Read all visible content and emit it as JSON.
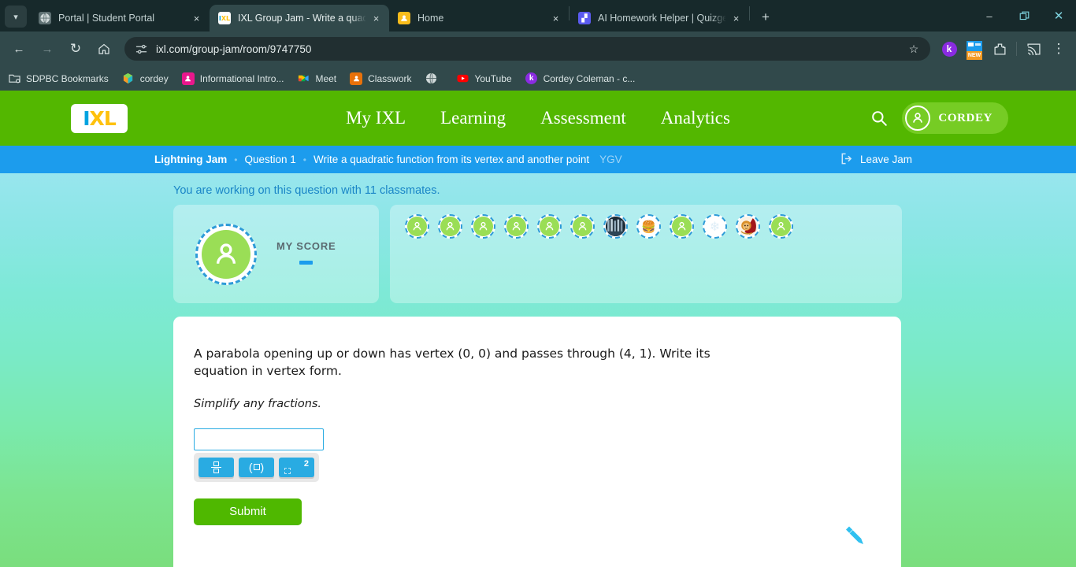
{
  "browser": {
    "tabs": [
      {
        "title": "Portal | Student Portal",
        "favicon": "globe-icon",
        "active": false
      },
      {
        "title": "IXL Group Jam - Write a quadra",
        "favicon": "ixl-icon",
        "active": true
      },
      {
        "title": "Home",
        "favicon": "classroom-icon",
        "active": false
      },
      {
        "title": "AI Homework Helper | Quizgeck",
        "favicon": "quizgecko-icon",
        "active": false
      }
    ],
    "new_tab_label": "+",
    "close_label": "×",
    "nav": {
      "back": "←",
      "forward": "→",
      "reload": "↻",
      "home": "⌂"
    },
    "omnibox": {
      "url": "ixl.com/group-jam/room/9747750",
      "site_info_icon": "tune-icon",
      "star_icon": "bookmark-star-icon"
    },
    "extensions": [
      {
        "name": "kami-extension",
        "letter": "k",
        "color": "#8a2be2"
      },
      {
        "name": "new-badge-extension",
        "letter": "NEW",
        "color": "#f59a23"
      },
      {
        "name": "puzzle-extension",
        "letter": "",
        "color": ""
      }
    ],
    "cast_icon": "cast-icon",
    "menu_icon": "three-dot-menu-icon",
    "window_controls": {
      "minimize": "–",
      "maximize": "❐",
      "close": "✕"
    },
    "bookmarks": [
      {
        "label": "SDPBC Bookmarks",
        "icon": "folder-settings-icon"
      },
      {
        "label": "cordey",
        "icon": "cube-icon"
      },
      {
        "label": "Informational Intro...",
        "icon": "contacts-icon"
      },
      {
        "label": "Meet",
        "icon": "meet-icon"
      },
      {
        "label": "Classwork",
        "icon": "classroom-icon"
      },
      {
        "label": "",
        "icon": "globe-icon"
      },
      {
        "label": "YouTube",
        "icon": "youtube-icon"
      },
      {
        "label": "Cordey Coleman - c...",
        "icon": "kami-icon"
      }
    ]
  },
  "ixl": {
    "logo": {
      "part1": "I",
      "part2": "XL"
    },
    "nav_links": [
      "My IXL",
      "Learning",
      "Assessment",
      "Analytics"
    ],
    "search_icon": "search-icon",
    "user": {
      "name": "CORDEY",
      "avatar_icon": "person-icon"
    },
    "jam_bar": {
      "title": "Lightning Jam",
      "separator": "•",
      "question_number": "Question 1",
      "skill_name": "Write a quadratic function from its vertex and another point",
      "skill_code": "YGV",
      "leave_label": "Leave Jam",
      "leave_icon": "exit-icon"
    },
    "classmates_notice": "You are working on this question with 11 classmates.",
    "score_panel": {
      "label": "MY SCORE",
      "value": "—",
      "avatar_icon": "person-icon"
    },
    "classmates": [
      {
        "type": "person",
        "icon": "person-icon"
      },
      {
        "type": "person",
        "icon": "person-icon"
      },
      {
        "type": "person",
        "icon": "person-icon"
      },
      {
        "type": "person",
        "icon": "person-icon"
      },
      {
        "type": "person",
        "icon": "person-icon"
      },
      {
        "type": "person",
        "icon": "person-icon"
      },
      {
        "type": "photo",
        "icon": "dark-photo-avatar"
      },
      {
        "type": "emoji",
        "icon": "hamburger-icon",
        "glyph": "🍔"
      },
      {
        "type": "person",
        "icon": "person-icon"
      },
      {
        "type": "emoji",
        "icon": "snowflake-icon",
        "glyph": "❄"
      },
      {
        "type": "photo",
        "icon": "lion-character-avatar"
      },
      {
        "type": "person",
        "icon": "person-icon"
      }
    ],
    "question": {
      "prompt": "A parabola opening up or down has vertex (0, 0) and passes through (4, 1). Write its equation in vertex form.",
      "hint": "Simplify any fractions.",
      "answer_value": "",
      "math_buttons": [
        {
          "name": "fraction-button",
          "label": "fraction"
        },
        {
          "name": "parentheses-button",
          "label": "()"
        },
        {
          "name": "exponent-button",
          "label": "2"
        }
      ],
      "submit_label": "Submit",
      "scratchpad_icon": "pencil-icon"
    }
  },
  "colors": {
    "ixl_green": "#53b700",
    "jam_blue": "#1c9ced",
    "submit_green": "#4fb800",
    "math_blue": "#29abe2",
    "avatar_green": "#9ade56"
  }
}
